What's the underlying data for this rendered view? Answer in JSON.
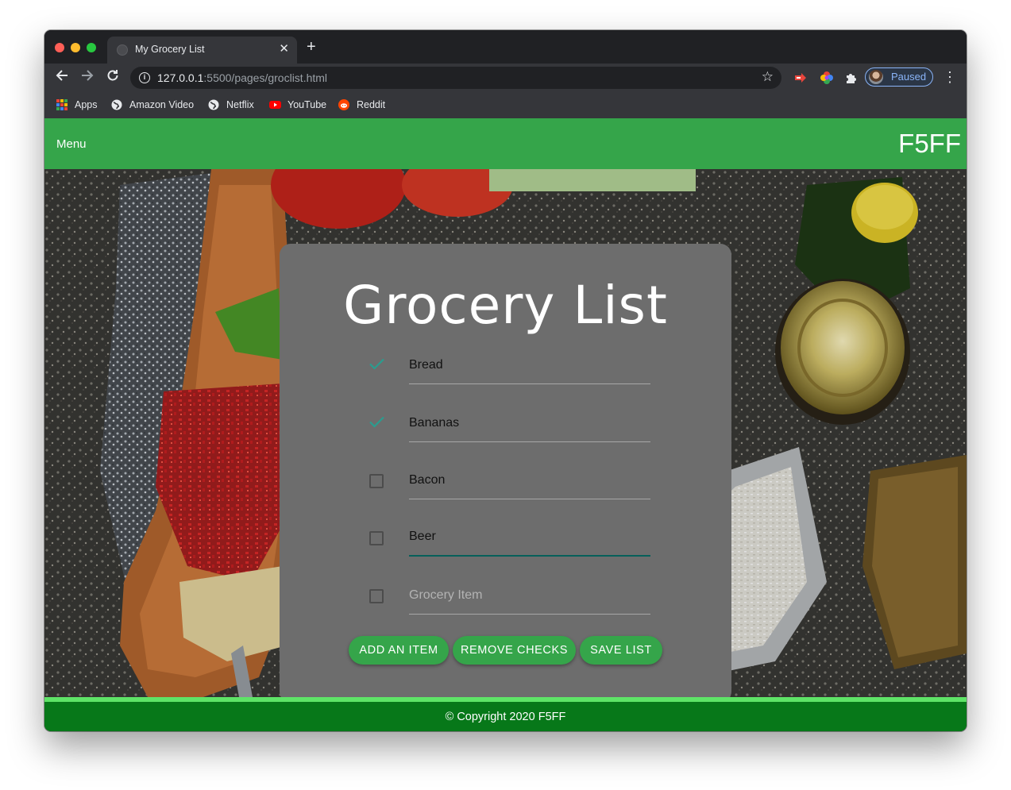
{
  "browser": {
    "tab_title": "My Grocery List",
    "url_host": "127.0.0.1",
    "url_rest": ":5500/pages/groclist.html",
    "profile_label": "Paused",
    "bookmarks": [
      {
        "label": "Apps",
        "icon": "apps-grid-icon"
      },
      {
        "label": "Amazon Video",
        "icon": "globe-icon"
      },
      {
        "label": "Netflix",
        "icon": "globe-icon"
      },
      {
        "label": "YouTube",
        "icon": "youtube-icon"
      },
      {
        "label": "Reddit",
        "icon": "reddit-icon"
      }
    ]
  },
  "navbar": {
    "menu_label": "Menu",
    "brand": "F5FF",
    "color": "#35a54a"
  },
  "grocery": {
    "title": "Grocery List",
    "items": [
      {
        "value": "Bread",
        "checked": true
      },
      {
        "value": "Bananas",
        "checked": true
      },
      {
        "value": "Bacon",
        "checked": false
      },
      {
        "value": "Beer",
        "checked": false,
        "focused": true
      },
      {
        "value": "",
        "placeholder": "Grocery Item",
        "checked": false
      }
    ],
    "buttons": {
      "add": "ADD AN ITEM",
      "remove": "REMOVE CHECKS",
      "save": "SAVE LIST"
    }
  },
  "footer": {
    "text": "© Copyright 2020 F5FF"
  }
}
